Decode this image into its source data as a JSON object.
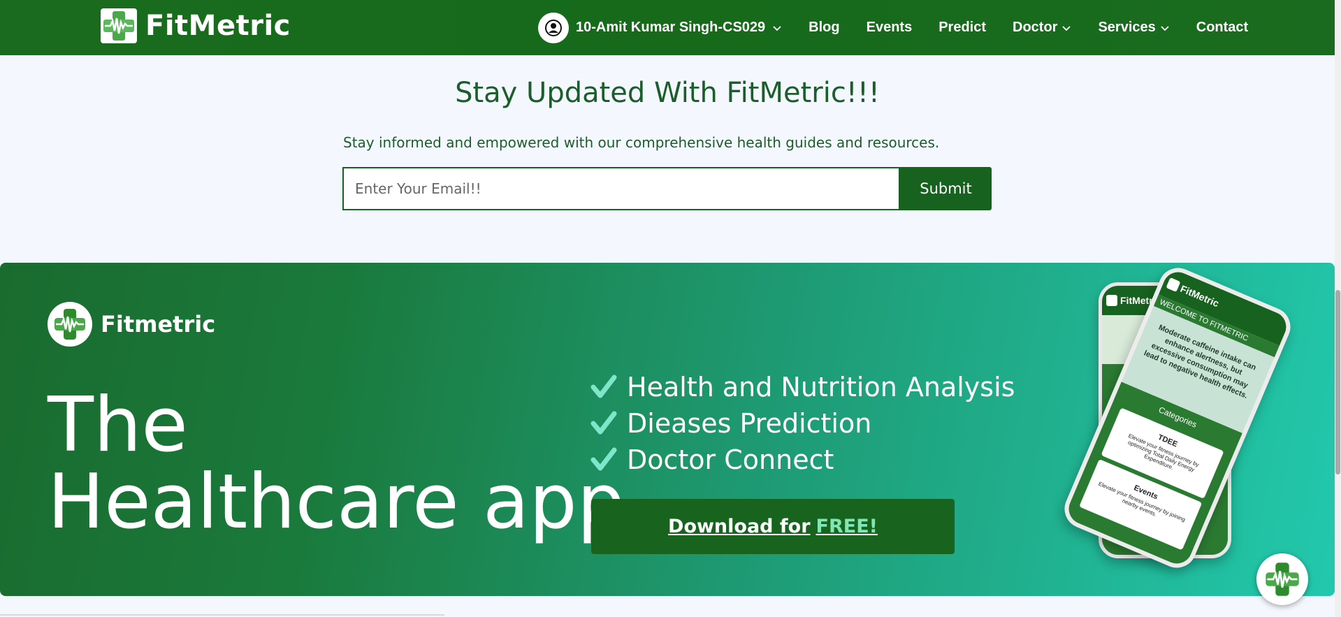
{
  "navbar": {
    "brand": "FitMetric",
    "user_name": "10-Amit Kumar Singh-CS029",
    "links": {
      "blog": "Blog",
      "events": "Events",
      "predict": "Predict",
      "doctor": "Doctor",
      "services": "Services",
      "contact": "Contact"
    }
  },
  "newsletter": {
    "title": "Stay Updated With FitMetric!!!",
    "subtitle": "Stay informed and empowered with our comprehensive health guides and resources.",
    "email_placeholder": "Enter Your Email!!",
    "submit_label": "Submit"
  },
  "banner": {
    "brand": "Fitmetric",
    "headline_line1": "The",
    "headline_line2": "Healthcare app",
    "features": [
      "Health and Nutrition Analysis",
      "Dieases Prediction",
      "Doctor Connect"
    ],
    "download_prefix": "Download for",
    "download_free": "FREE!",
    "phone": {
      "brand": "FitMetric",
      "welcome": "WELCOME TO FITMETRIC",
      "hero_text": "Moderate caffeine intake can enhance alertness, but excessive consumption may lead to negative health effects.",
      "categories": "Categories",
      "card1_title": "TDEE",
      "card1_text": "Elevate your fitness journey by optimizing Total Daily Energy Expenditure.",
      "card2_title": "Events",
      "card2_text": "Elevate your fitness journey by joining nearby events."
    }
  },
  "colors": {
    "brand_green": "#17621e",
    "accent_teal": "#22c8ad",
    "check_color": "#7fe6c9"
  }
}
